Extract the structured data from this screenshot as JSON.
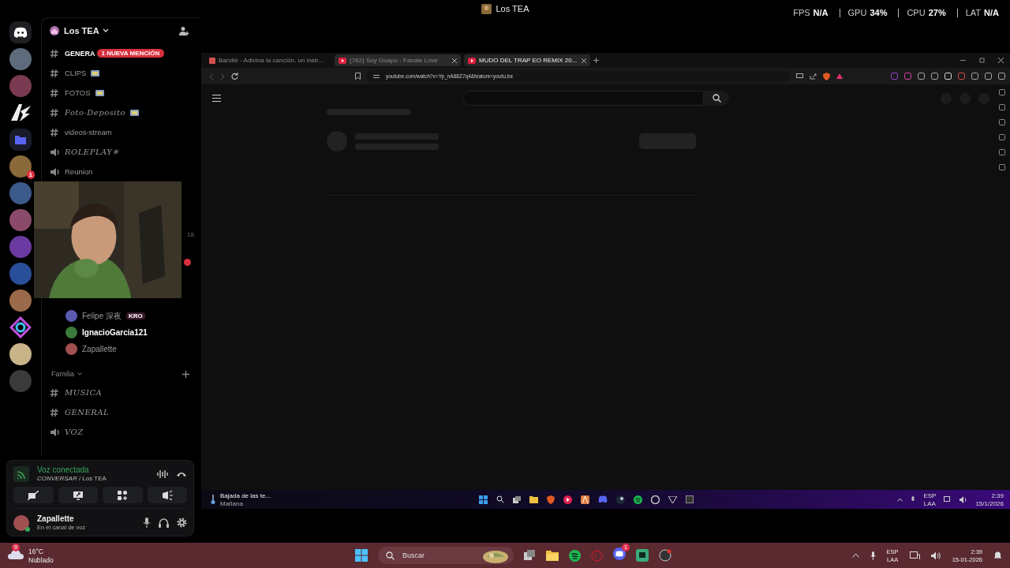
{
  "title_bar": {
    "title": "Los TEA"
  },
  "overlay_stats": [
    {
      "label": "FPS",
      "value": "N/A"
    },
    {
      "label": "GPU",
      "value": "34%"
    },
    {
      "label": "CPU",
      "value": "27%"
    },
    {
      "label": "LAT",
      "value": "N/A"
    }
  ],
  "servers": [
    {
      "kind": "discord"
    },
    {
      "kind": "avatar",
      "color": "#5d6b7c"
    },
    {
      "kind": "avatar",
      "color": "#7a3a52"
    },
    {
      "kind": "logo"
    },
    {
      "kind": "folder"
    },
    {
      "kind": "avatar",
      "color": "#8a6a3a",
      "badge": "1"
    },
    {
      "kind": "avatar",
      "color": "#3b5a8a"
    },
    {
      "kind": "avatar",
      "color": "#8a4a6a"
    },
    {
      "kind": "avatar",
      "color": "#6a3aa0"
    },
    {
      "kind": "avatar",
      "color": "#2a4f9a"
    },
    {
      "kind": "avatar",
      "color": "#9a6a4a"
    },
    {
      "kind": "ring"
    },
    {
      "kind": "avatar",
      "color": "#c9b48a"
    },
    {
      "kind": "avatar",
      "color": "#3a3a3a"
    }
  ],
  "sidebar": {
    "server_name": "Los TEA",
    "mention_banner": "1 NUEVA MENCIÓN",
    "channels": [
      {
        "kind": "text",
        "name": "GENERA",
        "unread": true,
        "fancy": false,
        "tag": false
      },
      {
        "kind": "text",
        "name": "CLIPS",
        "unread": false,
        "fancy": false,
        "tag": true
      },
      {
        "kind": "text",
        "name": "FOTOS",
        "unread": false,
        "fancy": false,
        "tag": true
      },
      {
        "kind": "text",
        "name": "Foto-Deposito",
        "unread": false,
        "fancy": true,
        "tag": true
      },
      {
        "kind": "text",
        "name": "videos-stream",
        "unread": false,
        "fancy": false,
        "tag": false
      },
      {
        "kind": "voice",
        "name": "ROLEPLAY✳",
        "unread": false,
        "fancy": true,
        "tag": false
      },
      {
        "kind": "voice",
        "name": "Reunion",
        "unread": false,
        "fancy": false,
        "tag": false
      }
    ],
    "side_count": "18",
    "voice_members": [
      {
        "name": "Felipe 深夜",
        "tag": "KRO",
        "highlighted": false,
        "color": "#5a5ab0"
      },
      {
        "name": "IgnacioGarcia121",
        "highlighted": true,
        "color": "#3a7a3a"
      },
      {
        "name": "Zapallette",
        "highlighted": false,
        "color": "#a05050"
      }
    ],
    "category": {
      "name": "Familia",
      "channels": [
        {
          "kind": "text",
          "name": "MUSICA"
        },
        {
          "kind": "text",
          "name": "GENERAL"
        },
        {
          "kind": "voice",
          "name": "VOZ"
        }
      ]
    },
    "voice_panel": {
      "status": "Voz conectada",
      "channel": "*CONVERSAR* / Los TEA"
    },
    "user": {
      "name": "Zapallette",
      "status": "En el canal de voz"
    }
  },
  "browser": {
    "tabs": [
      {
        "title": "Bandle - Adivina la canción, un instr...",
        "selected": false
      },
      {
        "title": "(782) Soy Guapo - Fanale Love",
        "selected": false
      },
      {
        "title": "MUDO DEL TRAP EO REMIX 20...",
        "selected": true
      }
    ],
    "url": "youtube.com/watch?v=Yp_nA68Z7q4&feature=youtu.be",
    "taskbar": {
      "weather": "Bajada de las te...",
      "weather_sub": "Mañana",
      "lang": "ESP",
      "layout": "LAA",
      "time": "2:39",
      "date": "15/1/2026"
    }
  },
  "taskbar": {
    "temperature": "16°C",
    "condition": "Nublado",
    "weather_badge": "9",
    "search": "Buscar",
    "discord_badge": "1",
    "lang": "ESP",
    "layout": "LAA",
    "time": "2:39",
    "date": "15-01-2026"
  }
}
